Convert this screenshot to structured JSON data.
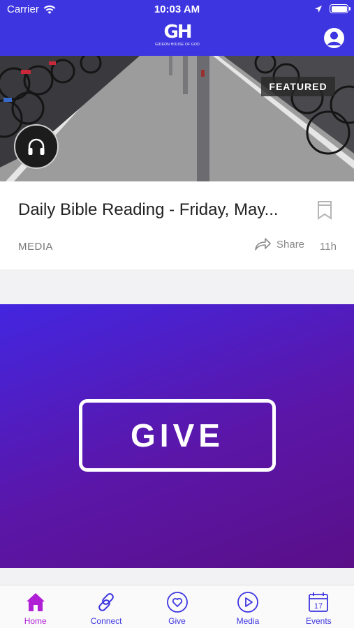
{
  "status_bar": {
    "carrier": "Carrier",
    "time": "10:03 AM"
  },
  "header": {
    "logo_mark": "GH",
    "logo_text": "GIDEON HOUSE OF GOD",
    "brand_color": "#3d35e0"
  },
  "featured": {
    "badge": "FEATURED",
    "title": "Daily Bible Reading - Friday, May...",
    "category": "MEDIA",
    "share_label": "Share",
    "age": "11h",
    "media_icon": "headphones-icon"
  },
  "give_banner": {
    "label": "GIVE",
    "gradient": [
      "#4326e0",
      "#5b16a8",
      "#5a0f88"
    ]
  },
  "tab_bar": {
    "active_color": "#b01fd6",
    "color": "#3d35e0",
    "tabs": [
      {
        "label": "Home",
        "icon": "home-icon",
        "active": true
      },
      {
        "label": "Connect",
        "icon": "link-icon",
        "active": false
      },
      {
        "label": "Give",
        "icon": "heart-icon",
        "active": false
      },
      {
        "label": "Media",
        "icon": "play-icon",
        "active": false
      },
      {
        "label": "Events",
        "icon": "calendar-icon",
        "active": false
      }
    ],
    "events_day": "17"
  }
}
